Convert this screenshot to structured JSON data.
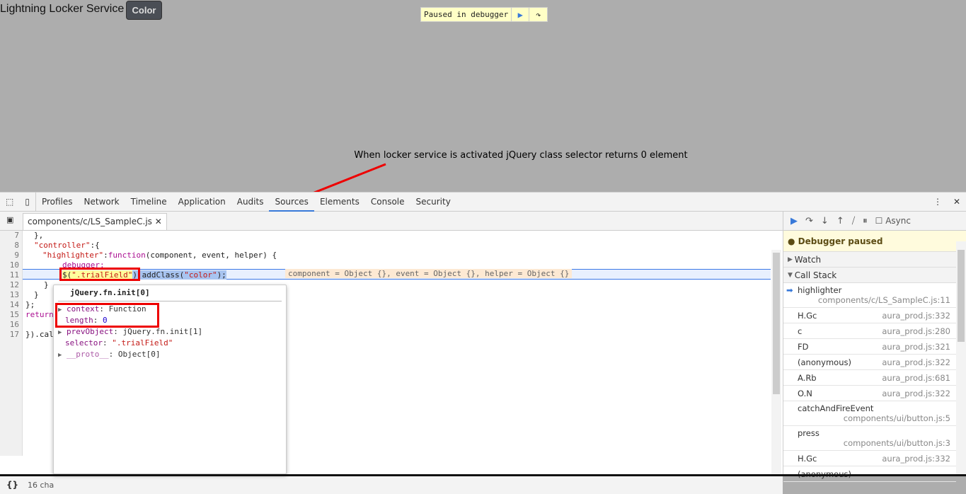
{
  "page": {
    "title": "Lightning Locker Service",
    "color_button": "Color"
  },
  "paused_overlay": {
    "label": "Paused in debugger"
  },
  "annotation": "When locker service is activated jQuery class selector returns 0 element",
  "devtools": {
    "tabs": [
      "Profiles",
      "Network",
      "Timeline",
      "Application",
      "Audits",
      "Sources",
      "Elements",
      "Console",
      "Security"
    ],
    "active_tab": "Sources",
    "file_tab": "components/c/LS_SampleC.js",
    "line_numbers": [
      "7",
      "8",
      "9",
      "10",
      "11",
      "12",
      "13",
      "14",
      "15",
      "16",
      "17"
    ],
    "code": {
      "l7": "},",
      "l8a": "\"controller\"",
      "l8b": ":{",
      "l9a": "\"highlighter\"",
      "l9b": ":",
      "l9c": "function",
      "l9d": "(component, event, helper) {",
      "l10": "debugger;",
      "l11a": "$(",
      "l11b": "\".trialField\"",
      "l11c": ").addClass(",
      "l11d": "\"color\"",
      "l11e": ");",
      "l12": "}",
      "l13": "}",
      "l14": "};",
      "l15": "return",
      "l16": "",
      "l17": "}).cal"
    },
    "inline_values": "component = Object {}, event = Object {}, helper = Object {}",
    "popover": {
      "title": "jQuery.fn.init[0]",
      "props": [
        {
          "key": "context",
          "value": "Function"
        },
        {
          "key": "length",
          "value": "0"
        },
        {
          "key": "prevObject",
          "value": "jQuery.fn.init[1]"
        },
        {
          "key": "selector",
          "value": "\".trialField\""
        },
        {
          "key": "__proto__",
          "value": "Object[0]"
        }
      ]
    },
    "status": "16 cha",
    "debugger": {
      "async_label": "Async",
      "paused_message": "Debugger paused",
      "watch": "Watch",
      "call_stack": "Call Stack",
      "frames": [
        {
          "name": "highlighter",
          "loc": "components/c/LS_SampleC.js:11"
        },
        {
          "name": "H.Gc",
          "loc": "aura_prod.js:332"
        },
        {
          "name": "c",
          "loc": "aura_prod.js:280"
        },
        {
          "name": "FD",
          "loc": "aura_prod.js:321"
        },
        {
          "name": "(anonymous)",
          "loc": "aura_prod.js:322"
        },
        {
          "name": "A.Rb",
          "loc": "aura_prod.js:681"
        },
        {
          "name": "O.N",
          "loc": "aura_prod.js:322"
        },
        {
          "name": "catchAndFireEvent",
          "loc": "components/ui/button.js:5"
        },
        {
          "name": "press",
          "loc": "components/ui/button.js:3"
        },
        {
          "name": "H.Gc",
          "loc": "aura_prod.js:332"
        },
        {
          "name": "(anonymous)",
          "loc": ""
        }
      ]
    }
  }
}
